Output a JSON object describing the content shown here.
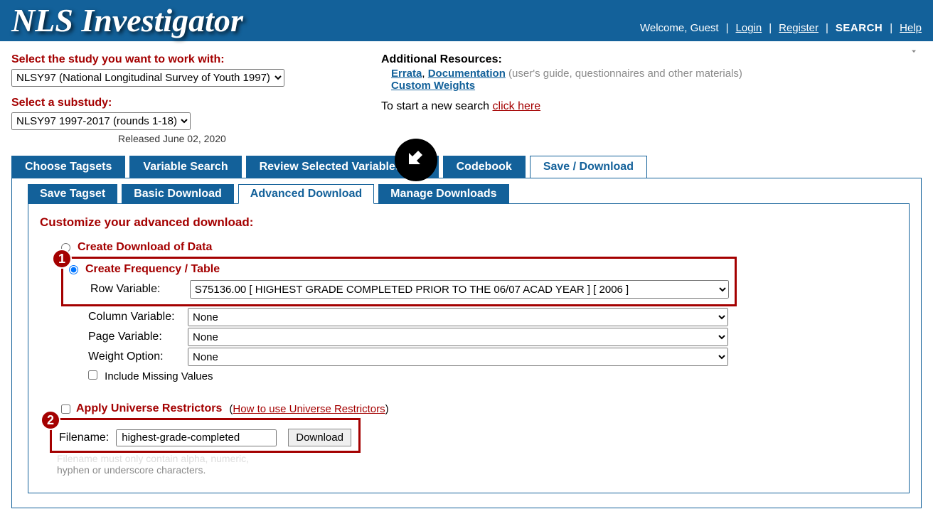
{
  "header": {
    "title": "NLS Investigator",
    "welcome": "Welcome, Guest",
    "links": {
      "login": "Login",
      "register": "Register",
      "search": "SEARCH",
      "help": "Help"
    }
  },
  "study": {
    "select_label": "Select the study you want to work with:",
    "selected": "NLSY97 (National Longitudinal Survey of Youth 1997)",
    "sub_label": "Select a substudy:",
    "sub_selected": "NLSY97 1997-2017 (rounds 1-18)",
    "released": "Released June 02, 2020"
  },
  "resources": {
    "heading": "Additional Resources:",
    "errata": "Errata",
    "documentation": "Documentation",
    "doc_hint": "(user's guide, questionnaires and other materials)",
    "custom_weights": "Custom Weights",
    "start_text": "To start a new search ",
    "click_here": "click here"
  },
  "main_tabs": {
    "choose": "Choose Tagsets",
    "varsearch": "Variable Search",
    "review": "Review Selected Variables (10)",
    "codebook": "Codebook",
    "save": "Save / Download"
  },
  "sub_tabs": {
    "save_tagset": "Save Tagset",
    "basic": "Basic Download",
    "advanced": "Advanced Download",
    "manage": "Manage Downloads"
  },
  "form": {
    "section_h": "Customize your advanced download:",
    "opt_download": "Create Download of Data",
    "opt_freq": "Create Frequency / Table",
    "row_label": "Row Variable:",
    "row_value": "S75136.00 [ HIGHEST GRADE COMPLETED PRIOR TO THE 06/07 ACAD YEAR ] [ 2006 ]",
    "col_label": "Column Variable:",
    "col_value": "None",
    "page_label": "Page Variable:",
    "page_value": "None",
    "weight_label": "Weight Option:",
    "weight_value": "None",
    "include_label": "Include Missing Values",
    "restrict_label": "Apply Universe Restrictors",
    "restrict_link": "How to use Universe Restrictors",
    "filename_label": "Filename:",
    "filename_value": "highest-grade-completed",
    "download_btn": "Download",
    "hint_line1": "Filename must only contain alpha, numeric,",
    "hint_line2": "hyphen or underscore characters."
  },
  "badges": {
    "one": "1",
    "two": "2"
  }
}
